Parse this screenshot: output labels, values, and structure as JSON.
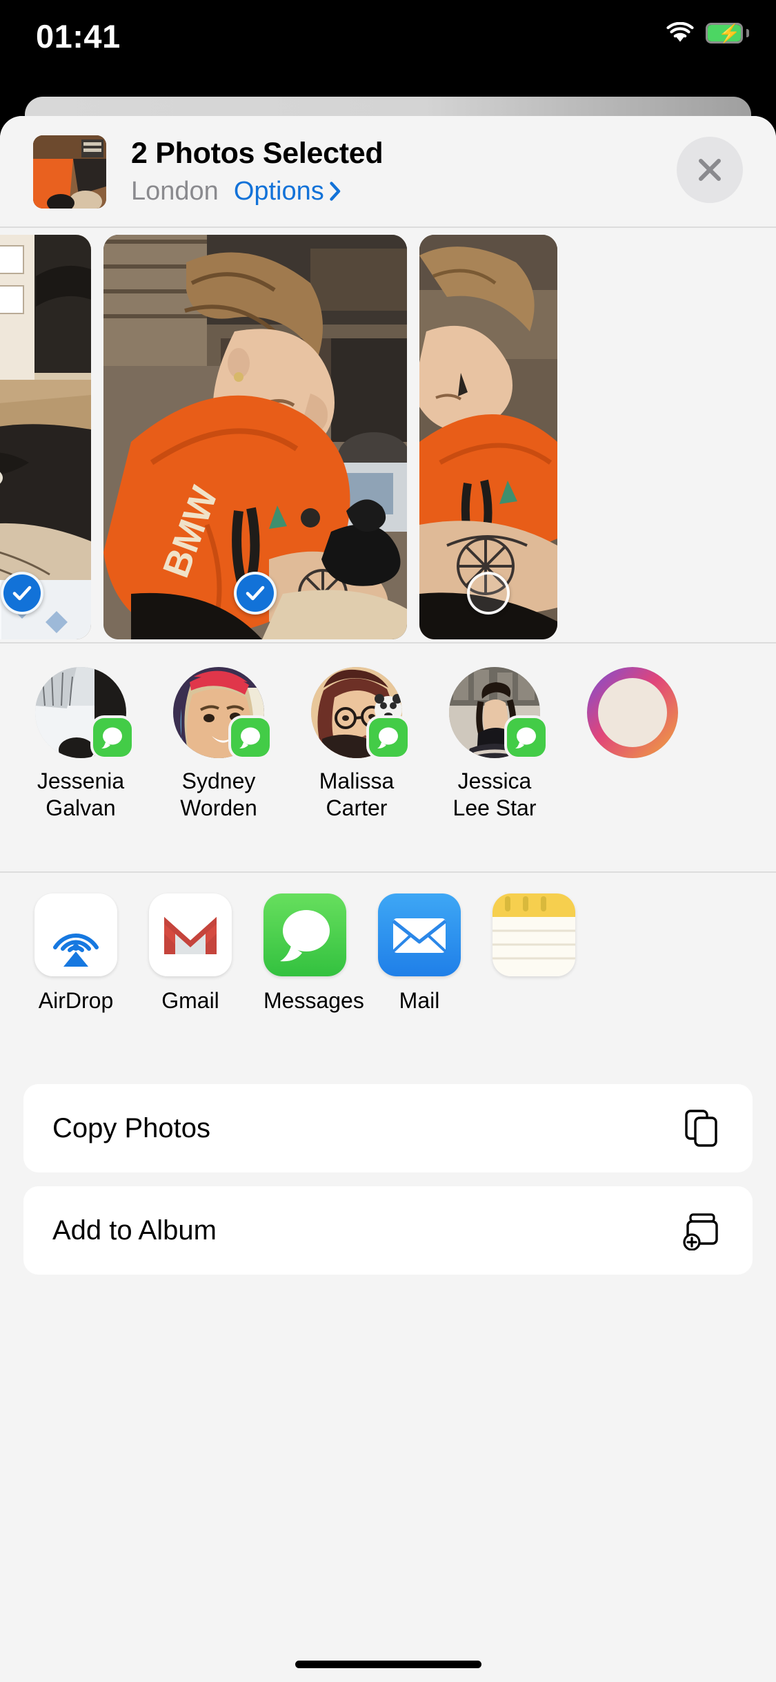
{
  "status_bar": {
    "time": "01:41",
    "wifi_icon": "wifi-icon",
    "battery_icon": "battery-charging-icon"
  },
  "share_sheet": {
    "header": {
      "thumbnail_name": "selected-photo-thumbnail",
      "title": "2 Photos Selected",
      "location": "London",
      "options_label": "Options",
      "options_chevron": "chevron-right-icon",
      "close_icon": "close-icon",
      "accent_color": "#1272d8",
      "subtitle_color": "#8a8a8e"
    },
    "photos": [
      {
        "name": "photo-1",
        "selected": true,
        "partial": true
      },
      {
        "name": "photo-2",
        "selected": true,
        "partial": false
      },
      {
        "name": "photo-3",
        "selected": false,
        "partial": true
      }
    ],
    "contacts": [
      {
        "name": "Jessenia Galvan",
        "badge": "messages-badge-icon"
      },
      {
        "name": "Sydney Worden",
        "badge": "messages-badge-icon"
      },
      {
        "name": "Malissa Carter",
        "badge": "messages-badge-icon"
      },
      {
        "name": "Jessica Lee Star",
        "badge": "messages-badge-icon"
      },
      {
        "name": "",
        "badge": ""
      }
    ],
    "apps": [
      {
        "label": "AirDrop",
        "icon": "airdrop-icon"
      },
      {
        "label": "Gmail",
        "icon": "gmail-icon"
      },
      {
        "label": "Messages",
        "icon": "messages-icon"
      },
      {
        "label": "Mail",
        "icon": "mail-icon"
      },
      {
        "label": "",
        "icon": "notes-icon"
      }
    ],
    "actions": [
      {
        "label": "Copy Photos",
        "icon": "copy-icon"
      },
      {
        "label": "Add to Album",
        "icon": "add-to-album-icon"
      }
    ]
  }
}
